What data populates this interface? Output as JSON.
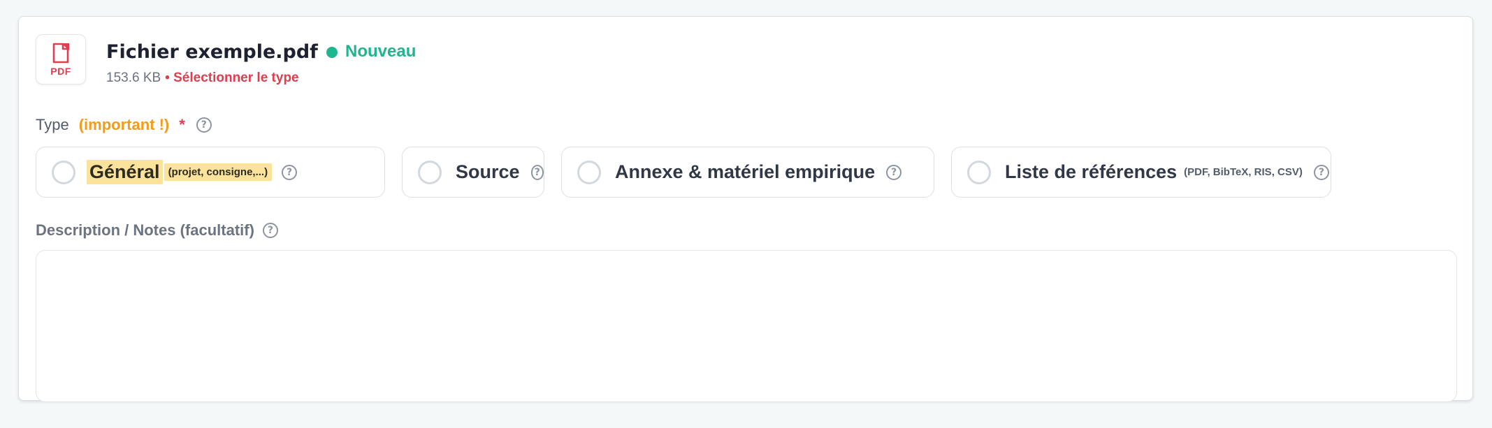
{
  "file": {
    "name": "Fichier exemple.pdf",
    "icon_label": "PDF",
    "status": "Nouveau",
    "size": "153.6 KB",
    "separator": "•",
    "select_type": "Sélectionner le type"
  },
  "type_field": {
    "label": "Type",
    "important": "(important !)",
    "required_mark": "*",
    "help": "?"
  },
  "options": [
    {
      "title": "Général",
      "hint": "(projet, consigne,...)",
      "selected": false,
      "highlighted": true
    },
    {
      "title": "Source",
      "hint": "",
      "selected": false
    },
    {
      "title": "Annexe & matériel empirique",
      "hint": "",
      "selected": false
    },
    {
      "title": "Liste de références",
      "hint": "(PDF, BibTeX, RIS, CSV)",
      "selected": false
    }
  ],
  "description": {
    "label": "Description / Notes (facultatif)",
    "value": "",
    "help": "?"
  },
  "colors": {
    "accent_green": "#1fb58e",
    "error_red": "#e23c4f",
    "important_orange": "#f39b1a",
    "highlight_yellow": "#fce39b"
  }
}
